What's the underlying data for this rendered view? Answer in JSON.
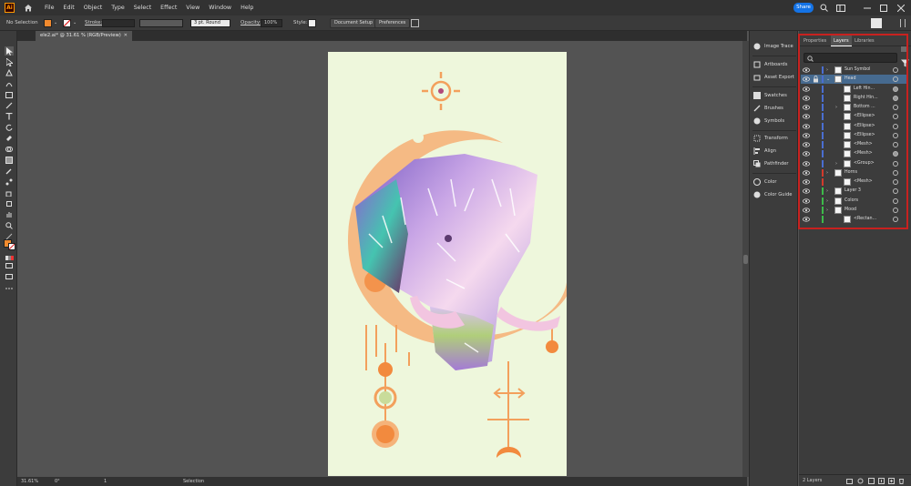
{
  "menu": {
    "app_logo_text": "Ai",
    "items": [
      "File",
      "Edit",
      "Object",
      "Type",
      "Select",
      "Effect",
      "View",
      "Window",
      "Help"
    ],
    "share_label": "Share"
  },
  "control": {
    "selection_label": "No Selection",
    "stroke_label": "Stroke:",
    "brush_value": "3 pt. Round",
    "opacity_label": "Opacity:",
    "opacity_value": "100%",
    "style_label": "Style:",
    "doc_setup_label": "Document Setup",
    "preferences_label": "Preferences",
    "fill_color": "#f28a2e"
  },
  "document": {
    "tab_title": "ele2.ai* @ 31.61 % (RGB/Preview)",
    "close_glyph": "✕"
  },
  "status": {
    "zoom": "31.61%",
    "rotation": "0°",
    "artboard_num": "1",
    "tool_name": "Selection"
  },
  "mid_panel": {
    "items": [
      "Image Trace",
      "Artboards",
      "Asset Export",
      "Swatches",
      "Brushes",
      "Symbols",
      "Transform",
      "Align",
      "Pathfinder",
      "Color",
      "Color Guide"
    ]
  },
  "right_panel": {
    "tabs": [
      "Properties",
      "Layers",
      "Libraries"
    ],
    "active_tab": "Layers",
    "layers": [
      {
        "name": "Sun Symbol",
        "level": 0,
        "expanded": false,
        "color": "#4a6ed1",
        "selected": false,
        "target_filled": false
      },
      {
        "name": "Head",
        "level": 0,
        "expanded": true,
        "color": "#4a6ed1",
        "selected": true,
        "target_filled": false
      },
      {
        "name": "Left Hin...",
        "level": 1,
        "expanded": null,
        "color": "#4a6ed1",
        "selected": false,
        "target_filled": true
      },
      {
        "name": "Right Hin...",
        "level": 1,
        "expanded": null,
        "color": "#4a6ed1",
        "selected": false,
        "target_filled": true
      },
      {
        "name": "Bottom ...",
        "level": 1,
        "expanded": false,
        "color": "#4a6ed1",
        "selected": false,
        "target_filled": false
      },
      {
        "name": "<Ellipse>",
        "level": 1,
        "expanded": null,
        "color": "#4a6ed1",
        "selected": false,
        "target_filled": false
      },
      {
        "name": "<Ellipse>",
        "level": 1,
        "expanded": null,
        "color": "#4a6ed1",
        "selected": false,
        "target_filled": false
      },
      {
        "name": "<Ellipse>",
        "level": 1,
        "expanded": null,
        "color": "#4a6ed1",
        "selected": false,
        "target_filled": false
      },
      {
        "name": "<Mesh>",
        "level": 1,
        "expanded": null,
        "color": "#4a6ed1",
        "selected": false,
        "target_filled": false
      },
      {
        "name": "<Mesh>",
        "level": 1,
        "expanded": null,
        "color": "#4a6ed1",
        "selected": false,
        "target_filled": true
      },
      {
        "name": "<Group>",
        "level": 1,
        "expanded": false,
        "color": "#4a6ed1",
        "selected": false,
        "target_filled": false
      },
      {
        "name": "Horns",
        "level": 0,
        "expanded": false,
        "color": "#d23a2c",
        "selected": false,
        "target_filled": false
      },
      {
        "name": "<Mesh>",
        "level": 1,
        "expanded": null,
        "color": "#d23a2c",
        "selected": false,
        "target_filled": false
      },
      {
        "name": "Layer 3",
        "level": 0,
        "expanded": false,
        "color": "#3dbb4a",
        "selected": false,
        "target_filled": false
      },
      {
        "name": "Colors",
        "level": 0,
        "expanded": false,
        "color": "#3dbb4a",
        "selected": false,
        "target_filled": false
      },
      {
        "name": "Mood",
        "level": 0,
        "expanded": false,
        "color": "#3dbb4a",
        "selected": false,
        "target_filled": false
      },
      {
        "name": "<Rectan...",
        "level": 1,
        "expanded": null,
        "color": "#3dbb4a",
        "selected": false,
        "target_filled": false
      }
    ],
    "layer_count": "2 Layers"
  }
}
